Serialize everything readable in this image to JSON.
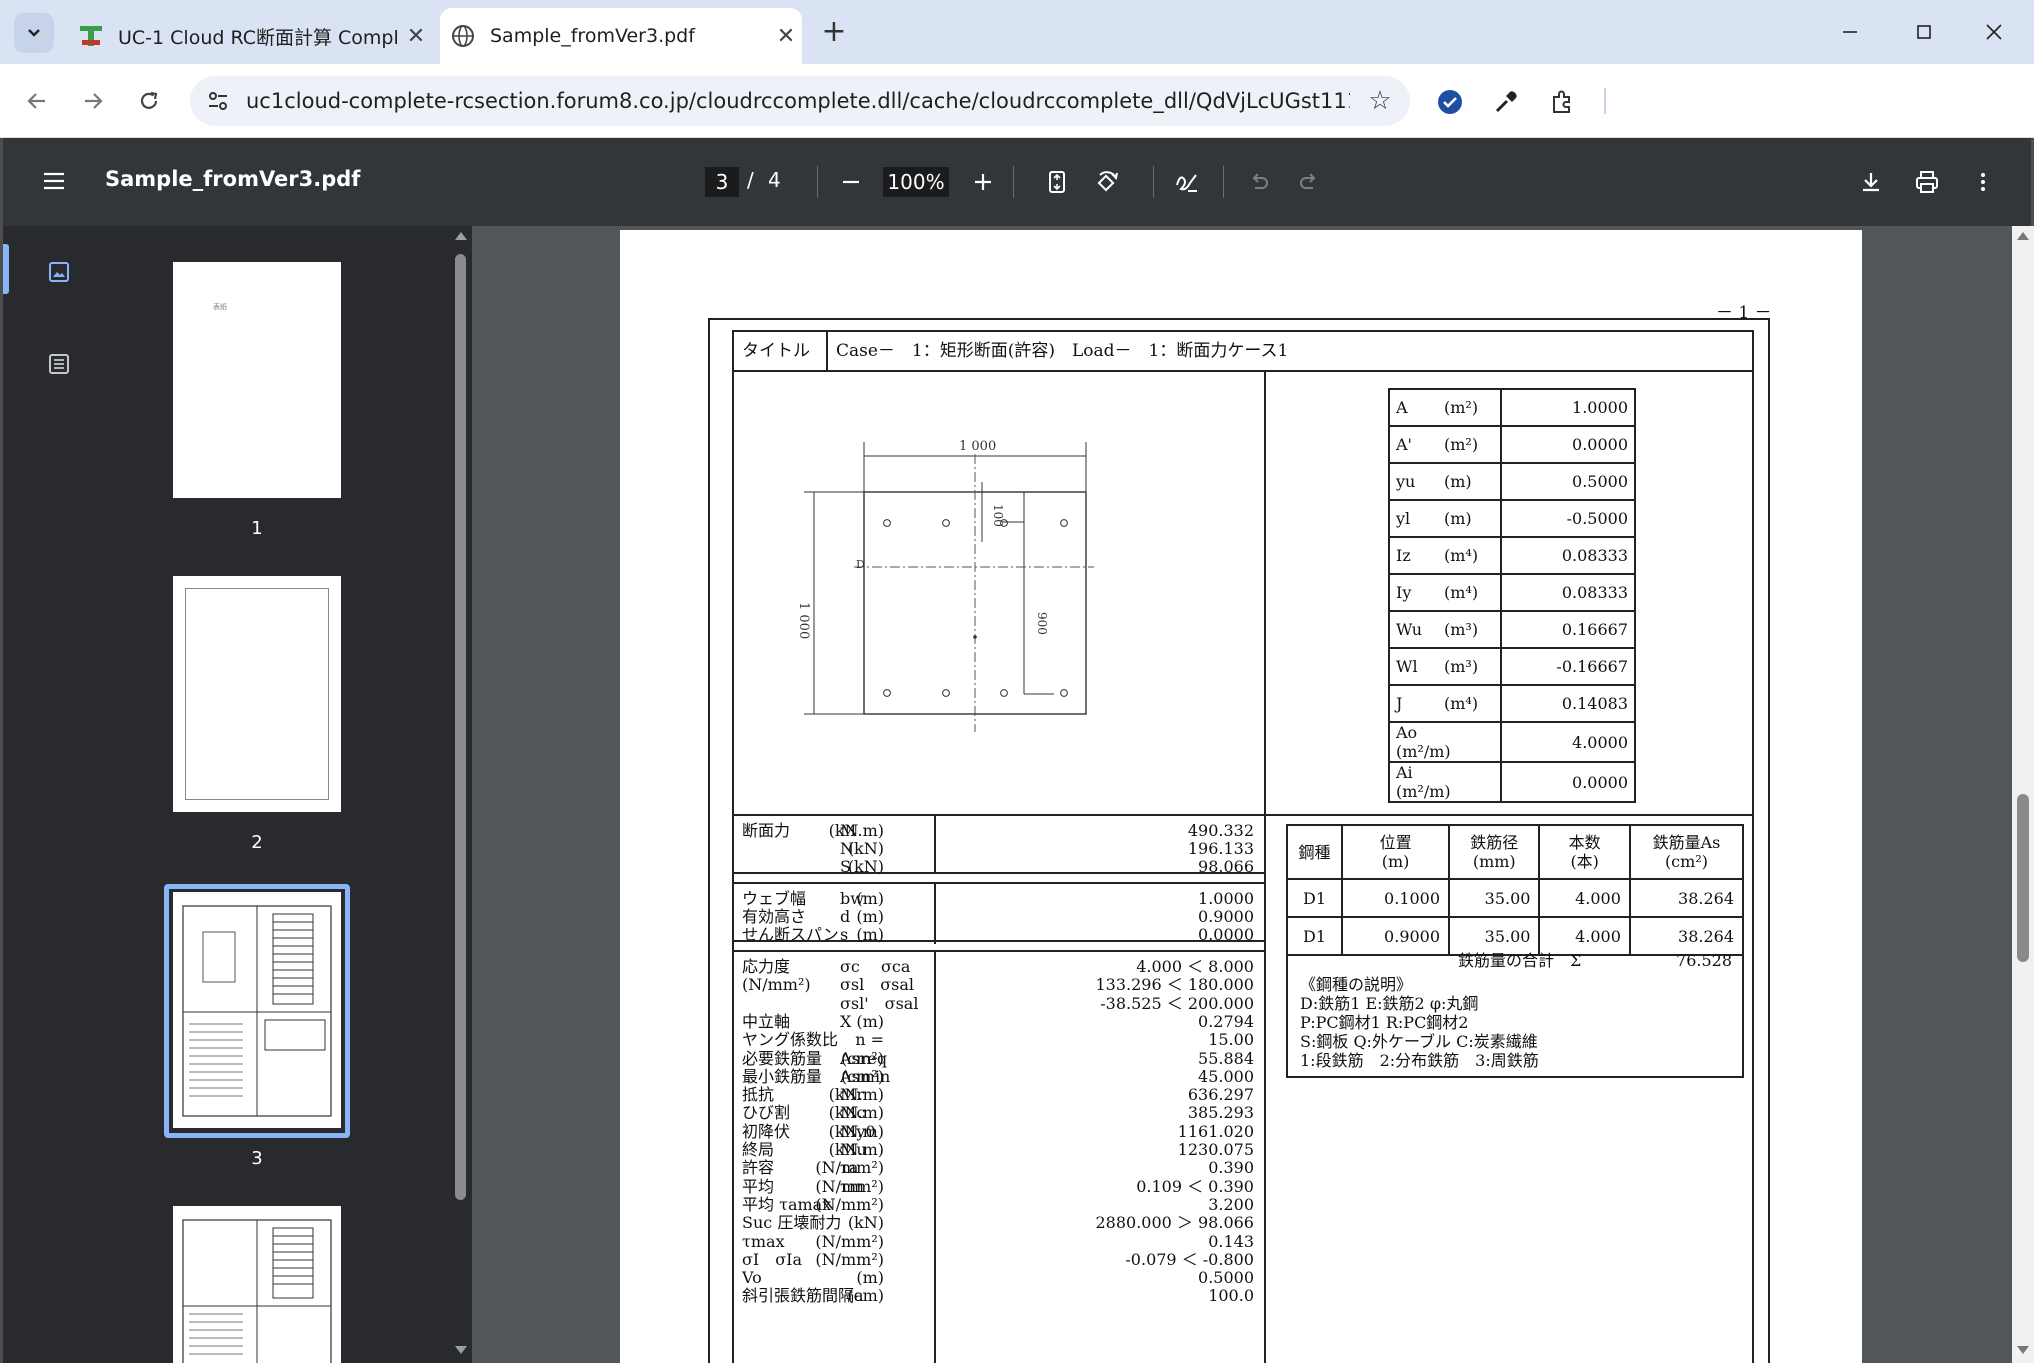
{
  "browser": {
    "tabs": [
      {
        "title": "UC-1 Cloud RC断面計算 Compl",
        "close": "✕"
      },
      {
        "title": "Sample_fromVer3.pdf",
        "close": "✕"
      }
    ],
    "new_tab": "+",
    "url": "uc1cloud-complete-rcsection.forum8.co.jp/cloudrccomplete.dll/cache/cloudrccomplete_dll/QdVjLcUGst11136C..."
  },
  "viewer": {
    "file_name": "Sample_fromVer3.pdf",
    "current_page": "3",
    "page_sep": "/",
    "total_pages": "4",
    "zoom": "100%",
    "thumbnails": [
      {
        "label": "1",
        "tiny_title": "表紙"
      },
      {
        "label": "2"
      },
      {
        "label": "3"
      },
      {
        "label": "4"
      }
    ]
  },
  "page": {
    "page_number": "－ 1 －",
    "title_label": "タイトル",
    "title_value": "Case－　1：矩形断面(許容)　Load－　1：断面力ケース1",
    "drawing": {
      "width_dim": "1 000",
      "height_dim": "1 000",
      "cover_dim": "100",
      "depth_dim": "900",
      "rebar_label": "D"
    },
    "section_props": [
      {
        "name": "A",
        "unit": "(m²)",
        "value": "1.0000"
      },
      {
        "name": "A'",
        "unit": "(m²)",
        "value": "0.0000"
      },
      {
        "name": "yu",
        "unit": "(m)",
        "value": "0.5000"
      },
      {
        "name": "yl",
        "unit": "(m)",
        "value": "-0.5000"
      },
      {
        "name": "Iz",
        "unit": "(m⁴)",
        "value": "0.08333"
      },
      {
        "name": "Iy",
        "unit": "(m⁴)",
        "value": "0.08333"
      },
      {
        "name": "Wu",
        "unit": "(m³)",
        "value": "0.16667"
      },
      {
        "name": "Wl",
        "unit": "(m³)",
        "value": "-0.16667"
      },
      {
        "name": "J",
        "unit": "(m⁴)",
        "value": "0.14083"
      },
      {
        "name": "Ao",
        "unit": "(m²/m)",
        "value": "4.0000"
      },
      {
        "name": "Ai",
        "unit": "(m²/m)",
        "value": "0.0000"
      }
    ],
    "forces": {
      "label": "断面力",
      "rows": [
        {
          "sym": "M",
          "unit": "(kN.m)",
          "value": "490.332"
        },
        {
          "sym": "N",
          "unit": "(kN)",
          "value": "196.133"
        },
        {
          "sym": "S",
          "unit": "(kN)",
          "value": "98.066"
        }
      ]
    },
    "dims": [
      {
        "name": "ウェブ幅",
        "sym": "bw",
        "unit": "(m)",
        "value": "1.0000"
      },
      {
        "name": "有効高さ",
        "sym": "d",
        "unit": "(m)",
        "value": "0.9000"
      },
      {
        "name": "せん断スパン",
        "sym": "s",
        "unit": "(m)",
        "value": "0.0000"
      }
    ],
    "results": [
      {
        "name": "応力度",
        "sym": "σc　 σca",
        "unit": "",
        "value": "4.000 ＜ 8.000"
      },
      {
        "name": "(N/mm²)",
        "sym": "σsl　σsal",
        "unit": "",
        "value": "133.296 ＜ 180.000"
      },
      {
        "name": "",
        "sym": "σsl'　σsal",
        "unit": "",
        "value": "-38.525 ＜ 200.000"
      },
      {
        "name": "中立軸",
        "sym": "X",
        "unit": "(m)",
        "value": "0.2794"
      },
      {
        "name": "ヤング係数比",
        "sym": "",
        "unit": "n =",
        "value": "15.00"
      },
      {
        "name": "必要鉄筋量",
        "sym": "Asreq",
        "unit": "(cm²)",
        "value": "55.884"
      },
      {
        "name": "最小鉄筋量",
        "sym": "Asmin",
        "unit": "(cm²)",
        "value": "45.000"
      },
      {
        "name": "抵抗",
        "sym": "Mr",
        "unit": "(kN.m)",
        "value": "636.297"
      },
      {
        "name": "ひび割",
        "sym": "Mc",
        "unit": "(kN.m)",
        "value": "385.293"
      },
      {
        "name": "初降伏",
        "sym": "My0",
        "unit": "(kN.m)",
        "value": "1161.020"
      },
      {
        "name": "終局",
        "sym": "Mu",
        "unit": "(kN.m)",
        "value": "1230.075"
      },
      {
        "name": "許容",
        "sym": "τa",
        "unit": "(N/mm²)",
        "value": "0.390"
      },
      {
        "name": "平均",
        "sym": "τm",
        "unit": "(N/mm²)",
        "value": "0.109 ＜ 0.390"
      },
      {
        "name": "平均 τamax",
        "sym": "",
        "unit": "(N/mm²)",
        "value": "3.200"
      },
      {
        "name": "Suc 圧壊耐力",
        "sym": "",
        "unit": "(kN)",
        "value": "2880.000 ＞ 98.066"
      },
      {
        "name": "τmax",
        "sym": "",
        "unit": "(N/mm²)",
        "value": "0.143"
      },
      {
        "name": "σI　σIa",
        "sym": "",
        "unit": "(N/mm²)",
        "value": "-0.079 ＜ -0.800"
      },
      {
        "name": "Vo",
        "sym": "",
        "unit": "(m)",
        "value": "0.5000"
      },
      {
        "name": "斜引張鉄筋間隔a",
        "sym": "",
        "unit": "(cm)",
        "value": "100.0"
      }
    ],
    "rebar_table": {
      "headers": [
        "鋼種",
        "位置\n(m)",
        "鉄筋径\n(mm)",
        "本数\n(本)",
        "鉄筋量As\n(cm²)"
      ],
      "rows": [
        [
          "D1",
          "0.1000",
          "35.00",
          "4.000",
          "38.264"
        ],
        [
          "D1",
          "0.9000",
          "35.00",
          "4.000",
          "38.264"
        ]
      ],
      "total_label": "鉄筋量の合計　Σ",
      "total_value": "76.528",
      "legend": [
        "《鋼種の説明》",
        "D:鉄筋1 E:鉄筋2 φ:丸鋼",
        "P:PC鋼材1 R:PC鋼材2",
        "S:鋼板 Q:外ケーブル C:炭素繊維",
        "1:段鉄筋　2:分布鉄筋　3:周鉄筋"
      ]
    }
  }
}
